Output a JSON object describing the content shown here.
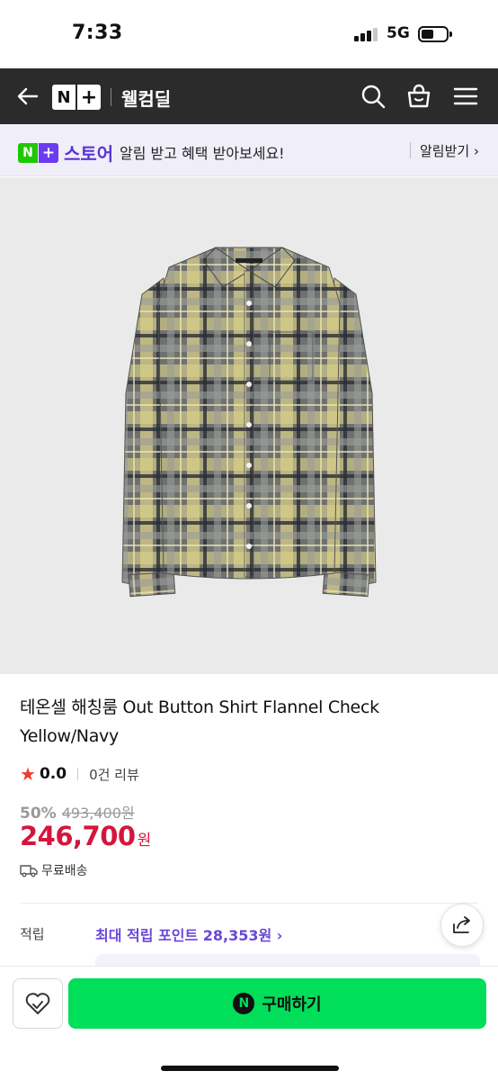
{
  "status_bar": {
    "time": "7:33",
    "network": "5G"
  },
  "nav": {
    "logo_n": "N",
    "logo_plus": "+",
    "title": "웰컴딜"
  },
  "store_banner": {
    "logo_n": "N",
    "logo_plus": "+",
    "logo_text": "스토어",
    "message": "알림 받고 혜택 받아보세요!",
    "alert_label": "알림받기 ›"
  },
  "product": {
    "title": "테온셀 해칭룸 Out Button Shirt Flannel Check Yellow/Navy",
    "rating": "0.0",
    "reviews": "0건 리뷰",
    "discount_rate": "50%",
    "original_price": "493,400원",
    "sale_price": "246,700",
    "currency": "원",
    "shipping": "무료배송"
  },
  "points": {
    "label": "적립",
    "value": "최대 적립 포인트 28,353원 ›"
  },
  "bottom_bar": {
    "npay": "N",
    "buy_label": "구매하기"
  },
  "colors": {
    "nav_bg": "#2b2b2b",
    "banner_bg": "#f0eef9",
    "price": "#d4163c",
    "points": "#6b46d9",
    "buy_button": "#00de5a"
  }
}
